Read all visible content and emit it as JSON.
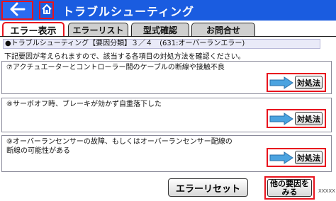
{
  "titlebar": {
    "title": "トラブルシューティング",
    "back_icon": "back-arrow-icon",
    "home_icon": "home-icon",
    "bg_color": "#1a5ce0"
  },
  "tabs": [
    {
      "label": "エラー表示",
      "active": true
    },
    {
      "label": "エラーリスト",
      "active": false
    },
    {
      "label": "型式確認",
      "active": false
    },
    {
      "label": "お問合せ",
      "active": false
    }
  ],
  "main": {
    "header": "●トラブルシューティング【要因分類】３／４　(631:オーバーランエラー)",
    "description": "下記要因が考えられますので、該当する各項目の対処方法を確認ください。",
    "causes": [
      {
        "lines": [
          "⑦アクチュエーターとコントローラー間のケーブルの断線や接触不良"
        ],
        "button_label": "対処法"
      },
      {
        "lines": [
          "⑧サーボオフ時、ブレーキが効かず自重落下した"
        ],
        "button_label": "対処法"
      },
      {
        "lines": [
          "⑨オーバーランセンサーの故障、もしくはオーバーランセンサー配線の",
          "断線の可能性がある"
        ],
        "button_label": "対処法"
      }
    ],
    "reset_label": "エラーリセット",
    "other_label_1": "他の要因を",
    "other_label_2": "みる",
    "code": "XXXXX",
    "highlight_color": "#e8141e"
  }
}
